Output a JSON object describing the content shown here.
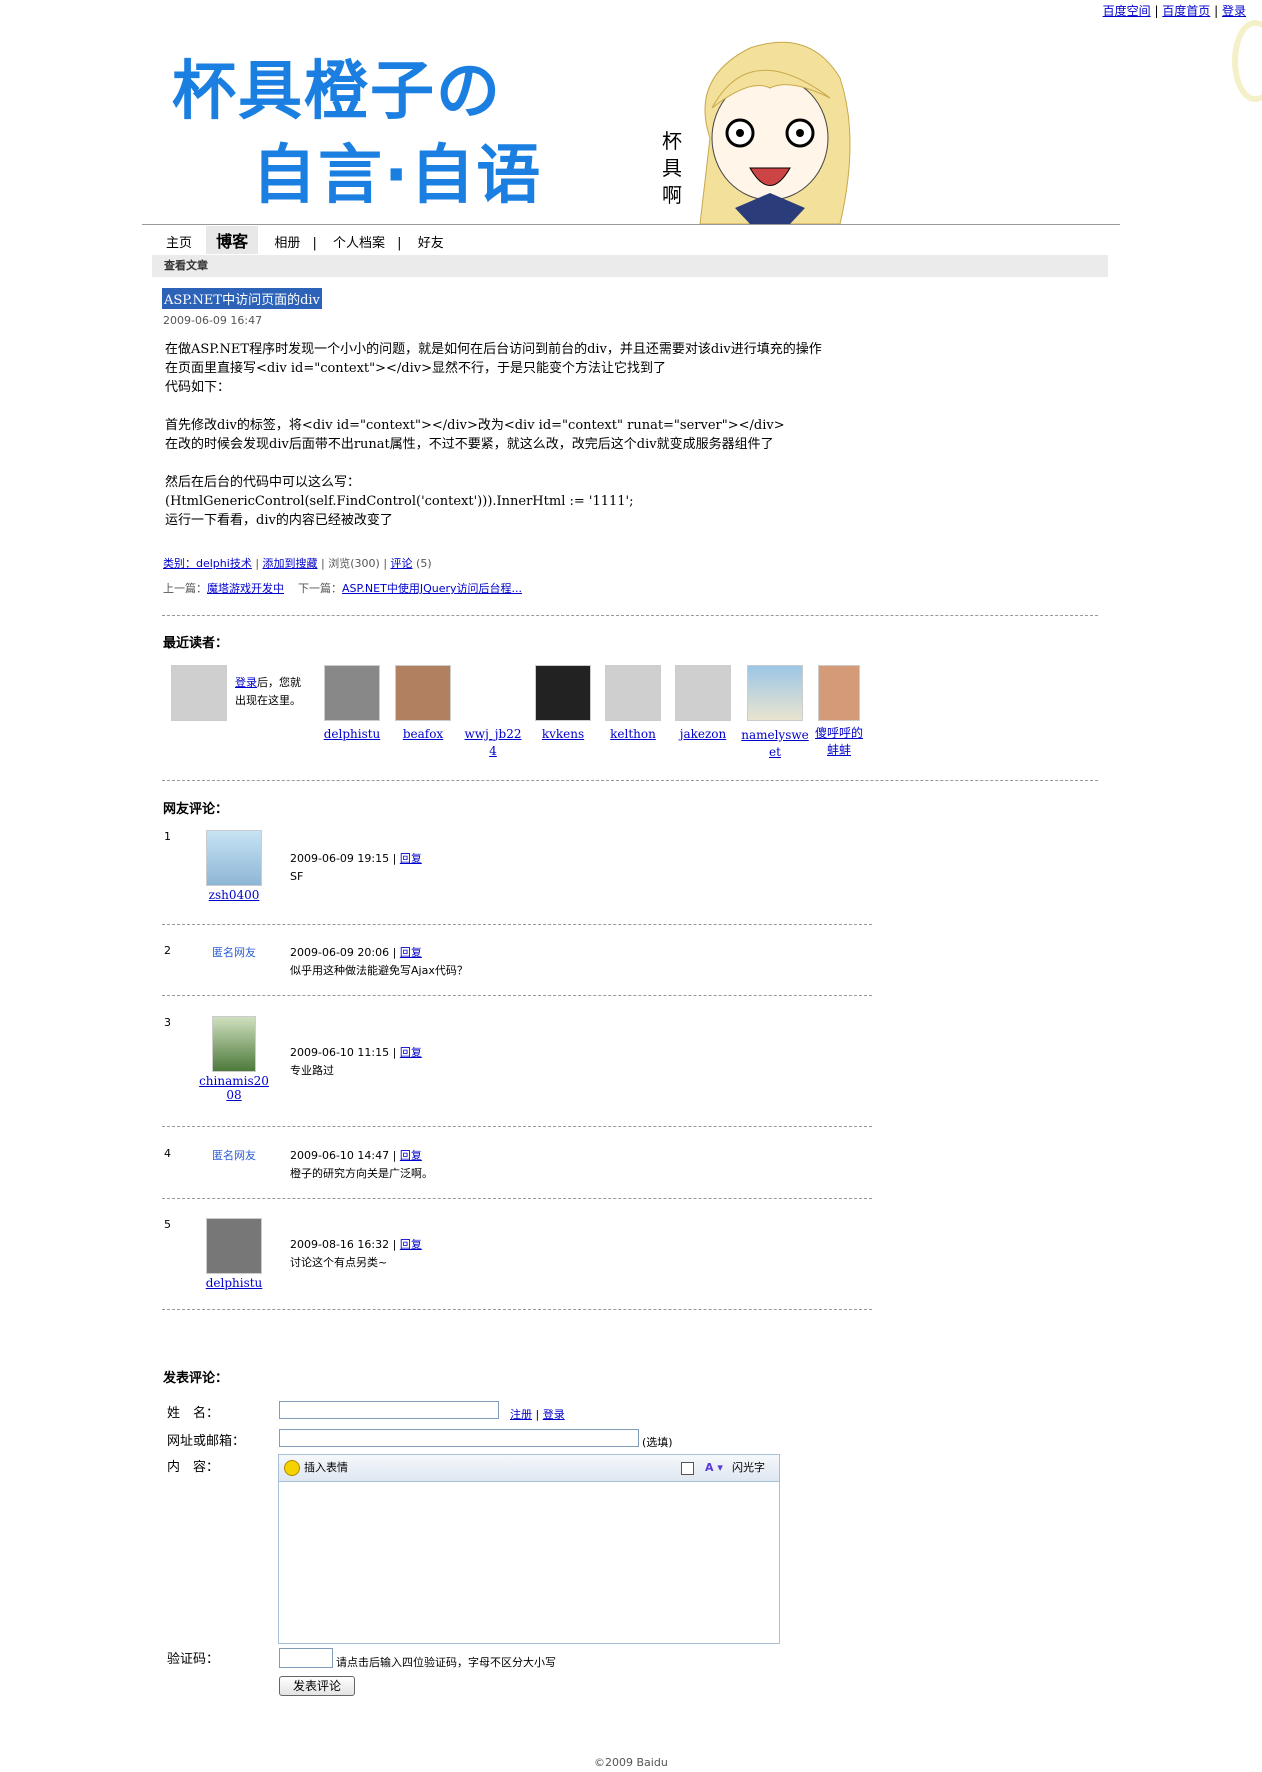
{
  "top_links": {
    "space": "百度空间",
    "home": "百度首页",
    "login": "登录"
  },
  "header": {
    "line1": "杯具橙子の",
    "line2": "自言·自语",
    "side_text": "杯具啊"
  },
  "nav": {
    "home": "主页",
    "blog": "博客",
    "album": "相册",
    "profile": "个人档案",
    "friends": "好友"
  },
  "section_header": "查看文章",
  "article": {
    "title": "ASP.NET中访问页面的div",
    "date": "2009-06-09 16:47",
    "p1": "在做ASP.NET程序时发现一个小小的问题，就是如何在后台访问到前台的div，并且还需要对该div进行填充的操作",
    "p2": "在页面里直接写<div id=\"context\"></div>显然不行，于是只能变个方法让它找到了",
    "p3": "代码如下：",
    "p4": "首先修改div的标签，将<div id=\"context\"></div>改为<div id=\"context\" runat=\"server\"></div>",
    "p5": "在改的时候会发现div后面带不出runat属性，不过不要紧，就这么改，改完后这个div就变成服务器组件了",
    "p6": "然后在后台的代码中可以这么写：",
    "p7": "(HtmlGenericControl(self.FindControl('context'))).InnerHtml := '1111';",
    "p8": "运行一下看看，div的内容已经被改变了"
  },
  "meta": {
    "category": "类别：delphi技术",
    "add": "添加到搜藏",
    "views": "浏览(300)",
    "comment": "评论",
    "comment_count": "(5)"
  },
  "nav_links": {
    "prev_label": "上一篇：",
    "prev": "魔塔游戏开发中",
    "next_label": "下一篇：",
    "next": "ASP.NET中使用JQuery访问后台程..."
  },
  "readers": {
    "title": "最近读者：",
    "login": "登录",
    "login_after": "后，您就",
    "login_after2": "出现在这里。",
    "list": [
      "delphistu",
      "beafox",
      "wwj_jb22",
      "4",
      "kvkens",
      "kelthon",
      "jakezon",
      "namelyswe",
      "et",
      "傻呼呼的",
      "蚌蚌"
    ]
  },
  "comments": {
    "title": "网友评论：",
    "reply": "回复",
    "items": [
      {
        "num": "1",
        "user": "zsh0400",
        "time": "2009-06-09 19:15",
        "text": "SF"
      },
      {
        "num": "2",
        "user": "匿名网友",
        "time": "2009-06-09 20:06",
        "text": "似乎用这种做法能避免写Ajax代码？"
      },
      {
        "num": "3",
        "user": "chinamis20",
        "user2": "08",
        "time": "2009-06-10 11:15",
        "text": "专业路过"
      },
      {
        "num": "4",
        "user": "匿名网友",
        "time": "2009-06-10 14:47",
        "text": "橙子的研究方向关是广泛啊。"
      },
      {
        "num": "5",
        "user": "delphistu",
        "time": "2009-08-16 16:32",
        "text": "讨论这个有点另类~"
      }
    ]
  },
  "form": {
    "title": "发表评论：",
    "name_label": "姓　名：",
    "register": "注册",
    "login": "登录",
    "url_label": "网址或邮箱：",
    "optional": "(选填)",
    "content_label": "内　容：",
    "emoticon": "插入表情",
    "flash": "闪光字",
    "captcha_label": "验证码：",
    "captcha_hint": "请点击后输入四位验证码，字母不区分大小写",
    "submit": "发表评论"
  },
  "footer": "©2009 Baidu"
}
